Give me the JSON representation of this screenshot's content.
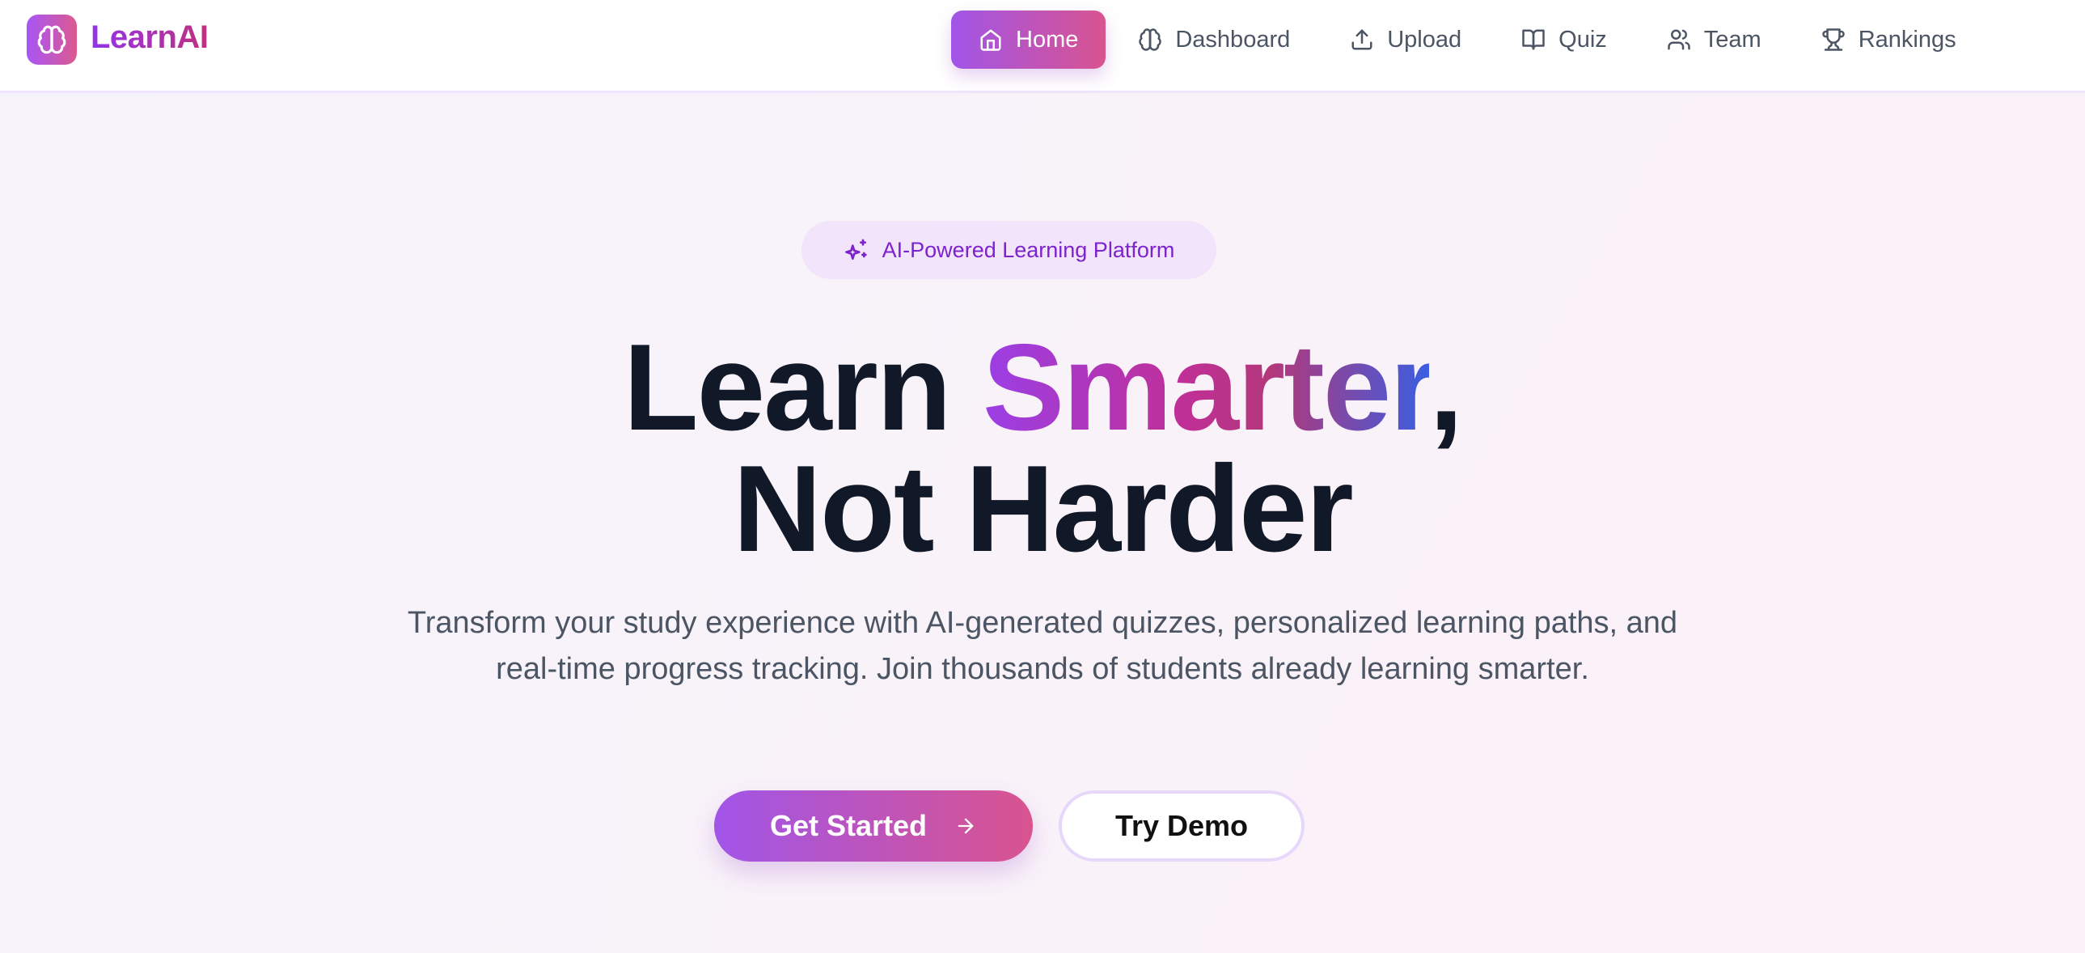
{
  "brand": {
    "name": "LearnAI",
    "icon": "brain-icon"
  },
  "nav": {
    "items": [
      {
        "label": "Home",
        "icon": "home-icon",
        "active": true
      },
      {
        "label": "Dashboard",
        "icon": "brain-icon"
      },
      {
        "label": "Upload",
        "icon": "upload-icon"
      },
      {
        "label": "Quiz",
        "icon": "book-open-icon"
      },
      {
        "label": "Team",
        "icon": "users-icon"
      },
      {
        "label": "Rankings",
        "icon": "trophy-icon"
      }
    ]
  },
  "hero": {
    "badge": "AI-Powered Learning Platform",
    "title_pre": "Learn ",
    "title_highlight": "Smarter",
    "title_comma": ",",
    "title_line2": "Not Harder",
    "description": "Transform your study experience with AI-generated quizzes, personalized learning paths, and real-time progress tracking. Join thousands of students already learning smarter.",
    "primary_button": "Get Started",
    "secondary_button": "Try Demo"
  },
  "colors": {
    "accent_start": "#a155e8",
    "accent_end": "#d9548f",
    "badge_text": "#7e22ce"
  }
}
